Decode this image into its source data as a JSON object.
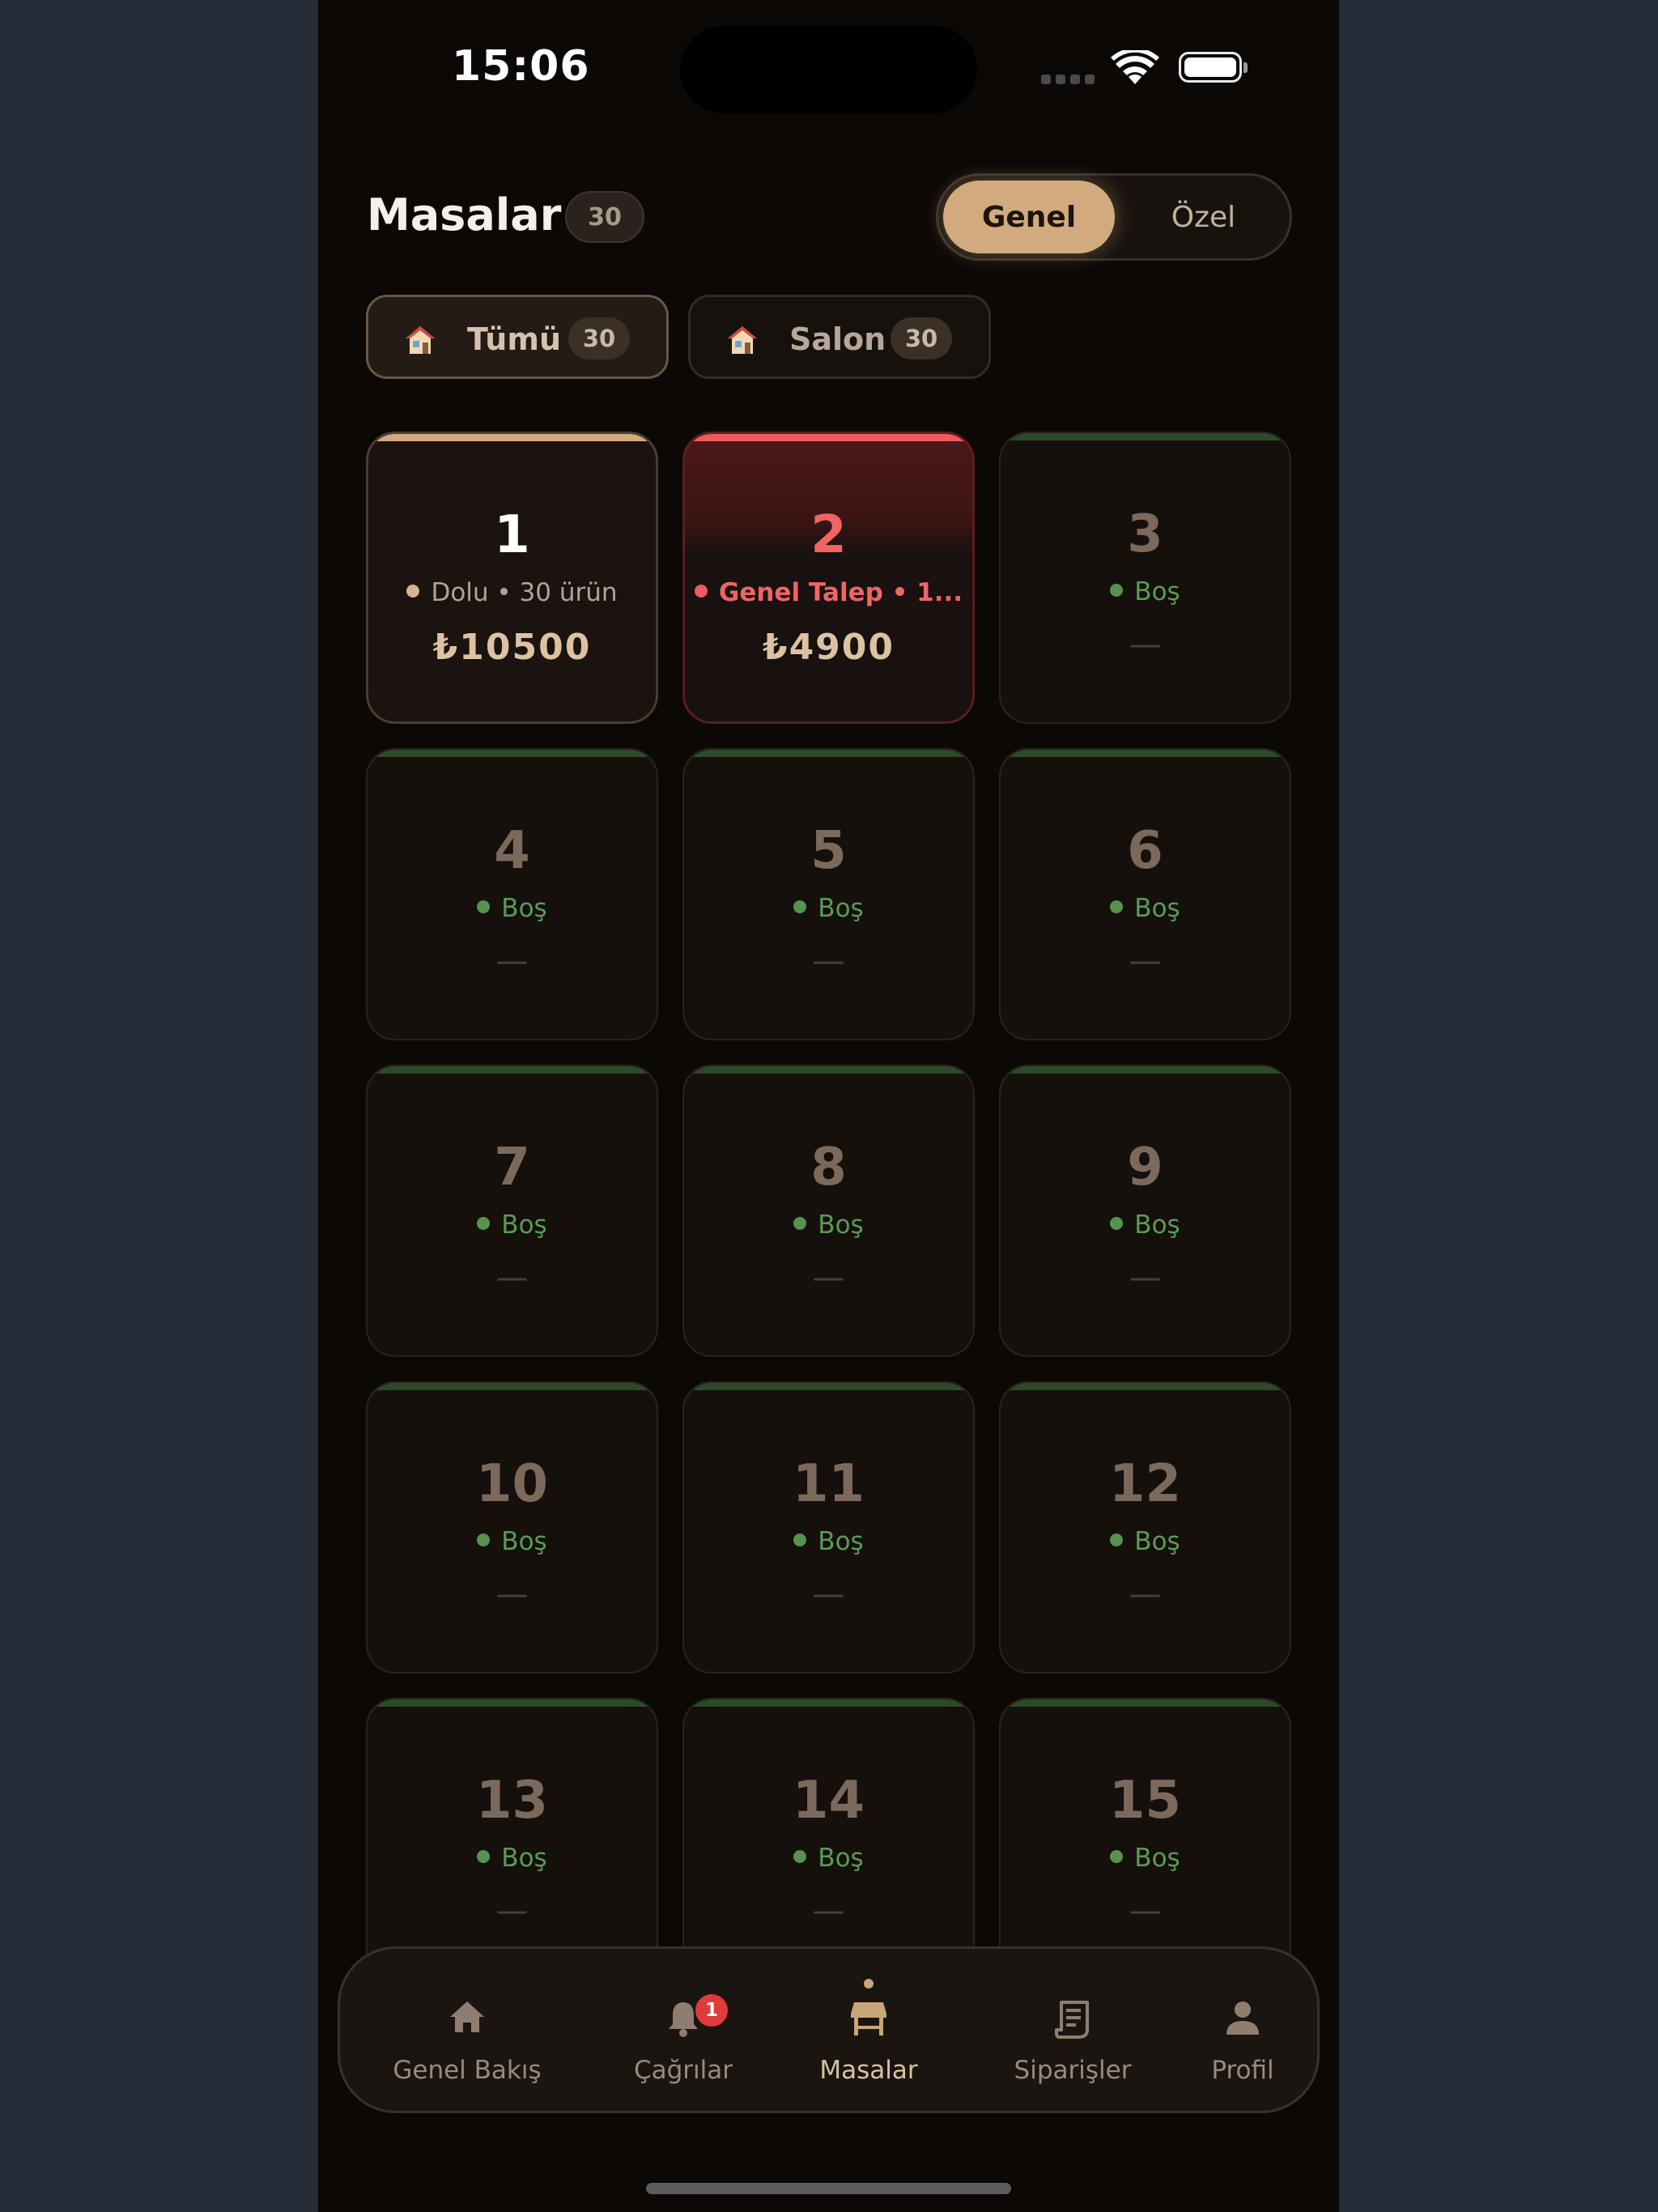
{
  "status_bar": {
    "time": "15:06"
  },
  "header": {
    "title": "Masalar",
    "count": "30"
  },
  "segment": {
    "active": "Genel",
    "inactive": "Özel"
  },
  "filters": [
    {
      "label": "Tümü",
      "count": "30",
      "icon": "house-emoji"
    },
    {
      "label": "Salon",
      "count": "30",
      "icon": "house-emoji"
    }
  ],
  "tables": [
    {
      "number": "1",
      "status": "Dolu • 30 ürün",
      "amount": "₺10500",
      "state": "occupied"
    },
    {
      "number": "2",
      "status": "Genel Talep • 1...",
      "amount": "₺4900",
      "state": "alert"
    },
    {
      "number": "3",
      "status": "Boş",
      "amount": "—",
      "state": "empty"
    },
    {
      "number": "4",
      "status": "Boş",
      "amount": "—",
      "state": "empty"
    },
    {
      "number": "5",
      "status": "Boş",
      "amount": "—",
      "state": "empty"
    },
    {
      "number": "6",
      "status": "Boş",
      "amount": "—",
      "state": "empty"
    },
    {
      "number": "7",
      "status": "Boş",
      "amount": "—",
      "state": "empty"
    },
    {
      "number": "8",
      "status": "Boş",
      "amount": "—",
      "state": "empty"
    },
    {
      "number": "9",
      "status": "Boş",
      "amount": "—",
      "state": "empty"
    },
    {
      "number": "10",
      "status": "Boş",
      "amount": "—",
      "state": "empty"
    },
    {
      "number": "11",
      "status": "Boş",
      "amount": "—",
      "state": "empty"
    },
    {
      "number": "12",
      "status": "Boş",
      "amount": "—",
      "state": "empty"
    },
    {
      "number": "13",
      "status": "Boş",
      "amount": "—",
      "state": "empty"
    },
    {
      "number": "14",
      "status": "Boş",
      "amount": "—",
      "state": "empty"
    },
    {
      "number": "15",
      "status": "Boş",
      "amount": "—",
      "state": "empty"
    }
  ],
  "nav": [
    {
      "label": "Genel Bakış",
      "icon": "home-icon"
    },
    {
      "label": "Çağrılar",
      "icon": "bell-icon",
      "badge": "1"
    },
    {
      "label": "Masalar",
      "icon": "table-icon",
      "active": true
    },
    {
      "label": "Siparişler",
      "icon": "receipt-icon"
    },
    {
      "label": "Profil",
      "icon": "person-icon"
    }
  ],
  "colors": {
    "accent": "#d1ab7d",
    "alert": "#ef5b5b",
    "empty_status": "#5a9c55",
    "background": "#0c0806"
  }
}
